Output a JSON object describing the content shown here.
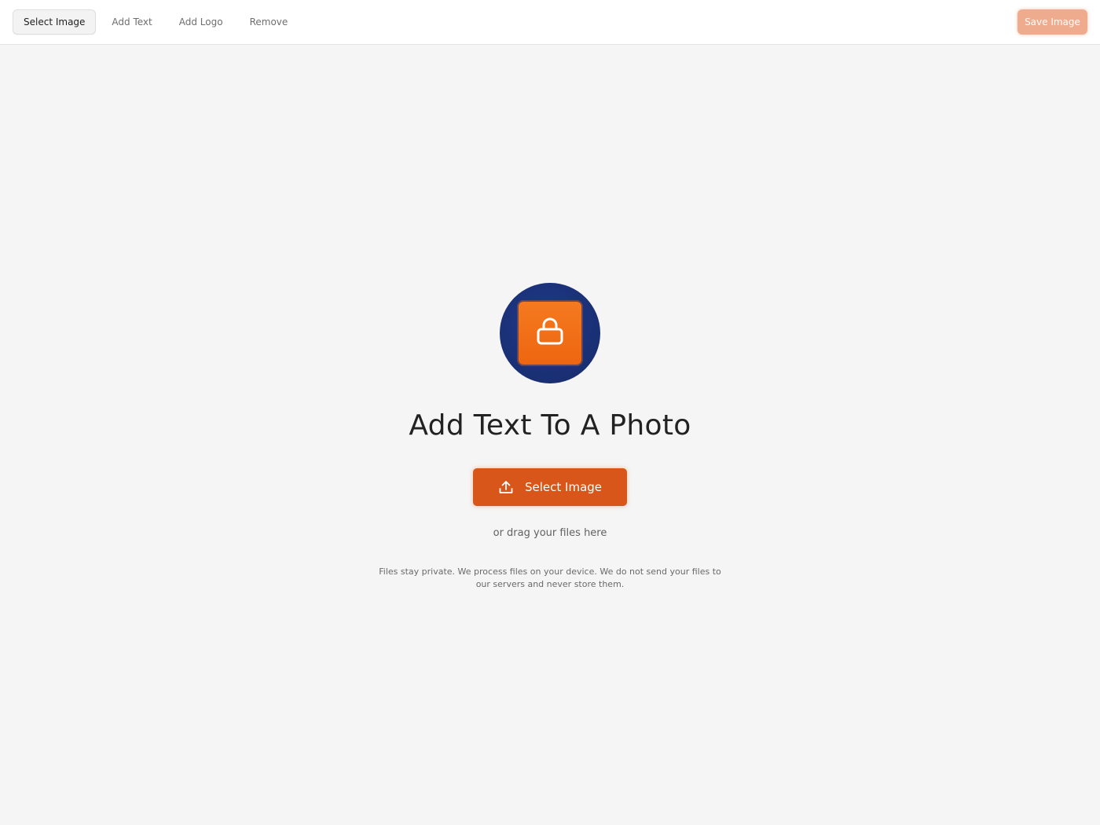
{
  "toolbar": {
    "tabs": [
      {
        "label": "Select Image",
        "active": true
      },
      {
        "label": "Add Text",
        "active": false
      },
      {
        "label": "Add Logo",
        "active": false
      },
      {
        "label": "Remove",
        "active": false
      }
    ],
    "save_label": "Save Image"
  },
  "main": {
    "logo_icon": "lock-icon",
    "title": "Add Text To A Photo",
    "select_button_label": "Select Image",
    "select_button_icon": "upload-icon",
    "drag_hint": "or drag your files here",
    "privacy_note": "Files stay private. We process files on your device. We do not send your files to our servers and never store them."
  },
  "colors": {
    "accent": "#d9561a",
    "accent_disabled": "#efab8d",
    "logo_square": "#f06a14",
    "logo_circle": "#1a2f73",
    "background": "#f5f5f5"
  }
}
